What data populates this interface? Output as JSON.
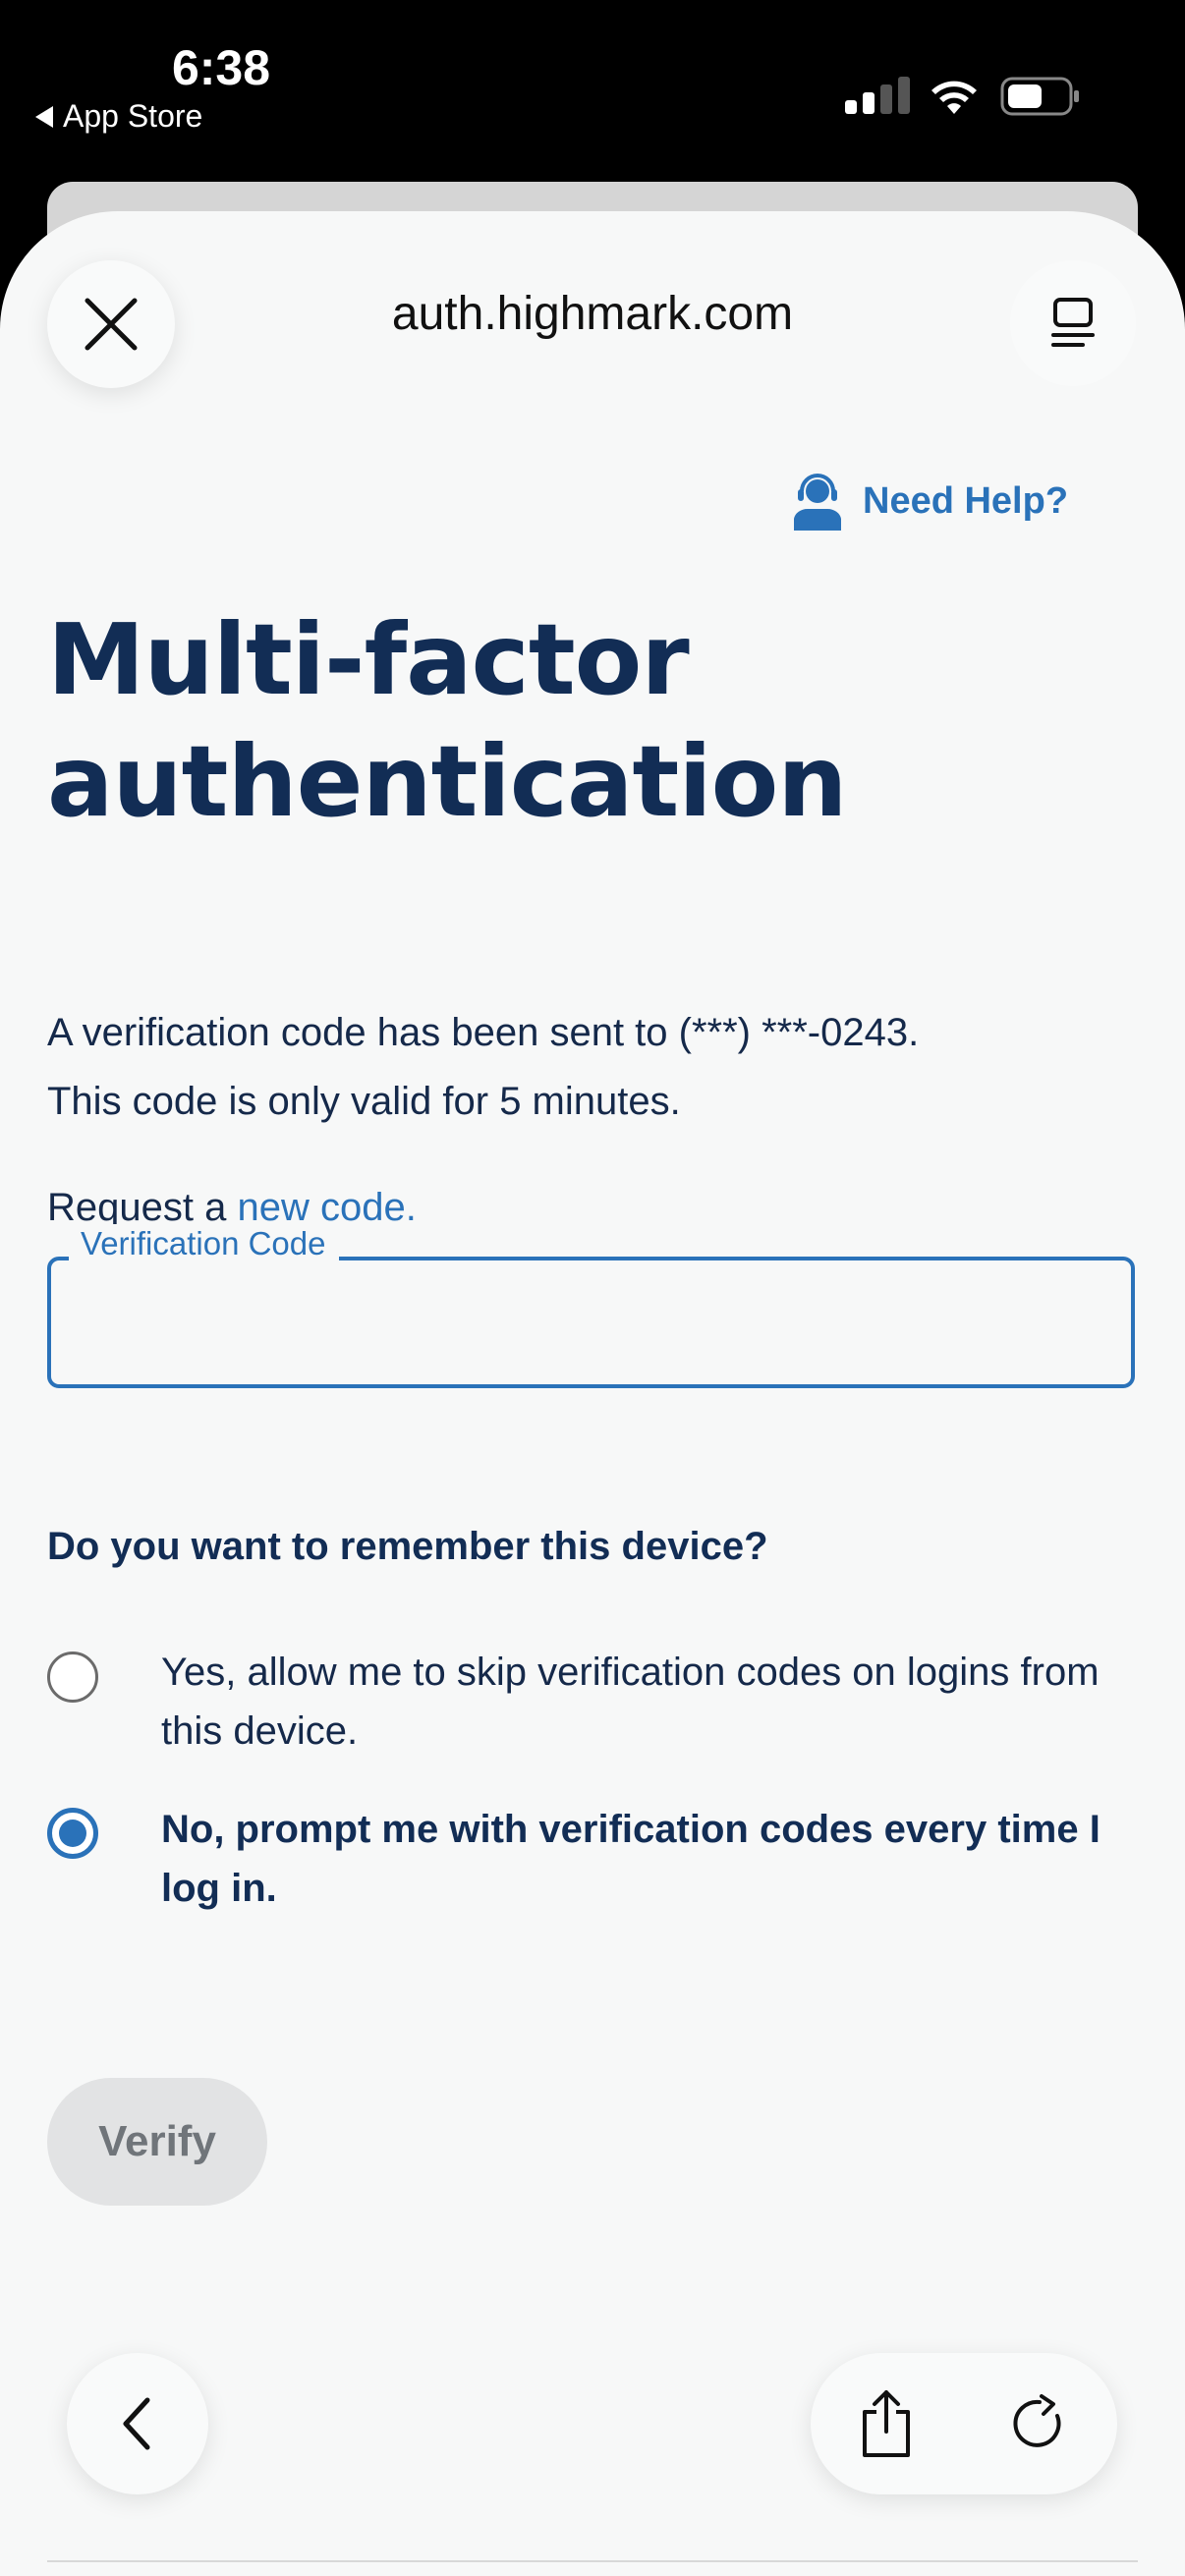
{
  "status_bar": {
    "time": "6:38",
    "back_app": "App Store"
  },
  "browser": {
    "url": "auth.highmark.com"
  },
  "help": {
    "label": "Need Help?"
  },
  "page": {
    "title_line1": "Multi-factor",
    "title_line2": "authentication",
    "sent_message": "A verification code has been sent to (***) ***-0243.",
    "valid_message": "This code is only valid for 5 minutes.",
    "request_prefix": "Request a",
    "request_link": "new code."
  },
  "code_field": {
    "label": "Verification Code",
    "value": ""
  },
  "remember": {
    "question": "Do you want to remember this device?",
    "options": [
      {
        "label": "Yes, allow me to skip verification codes on logins from this device.",
        "selected": false
      },
      {
        "label": "No, prompt me with verification codes every time I log in.",
        "selected": true
      }
    ]
  },
  "verify": {
    "label": "Verify",
    "enabled": false
  },
  "colors": {
    "brand_navy": "#122d55",
    "link_blue": "#2a72b9",
    "disabled_button": "#e2e3e4"
  }
}
